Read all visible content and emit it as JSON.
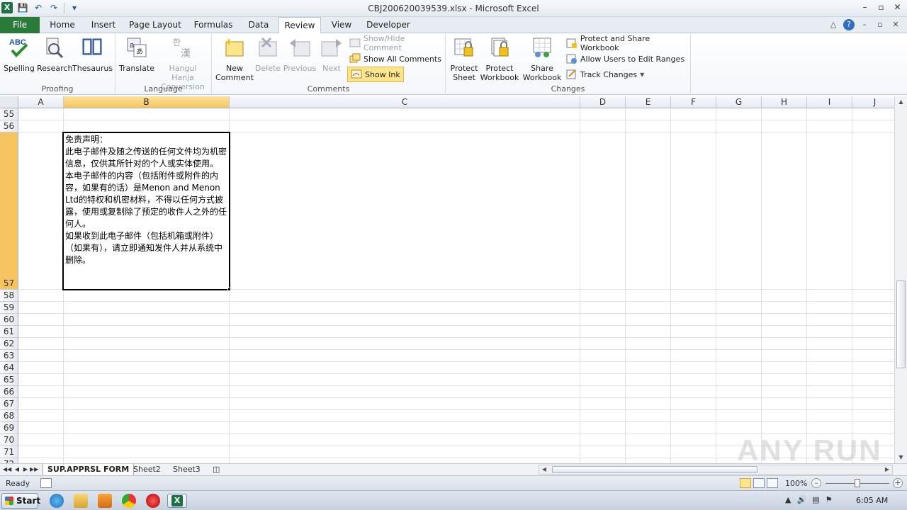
{
  "window": {
    "title": "CBJ200620039539.xlsx - Microsoft Excel",
    "controls": [
      "–",
      "▫",
      "✕"
    ]
  },
  "quick_access": {
    "logo": "X"
  },
  "ribbon": {
    "tabs": [
      "File",
      "Home",
      "Insert",
      "Page Layout",
      "Formulas",
      "Data",
      "Review",
      "View",
      "Developer"
    ],
    "active_tab": "Review",
    "groups": {
      "proofing": {
        "label": "Proofing",
        "buttons": [
          "Spelling",
          "Research",
          "Thesaurus"
        ]
      },
      "language": {
        "label": "Language",
        "translate": "Translate",
        "hangul_line1": "Hangul Hanja",
        "hangul_line2": "Conversion"
      },
      "comments": {
        "label": "Comments",
        "new_line1": "New",
        "new_line2": "Comment",
        "delete": "Delete",
        "previous": "Previous",
        "next": "Next",
        "show_hide": "Show/Hide Comment",
        "show_all": "Show All Comments",
        "show_ink": "Show Ink"
      },
      "changes": {
        "label": "Changes",
        "protect_sheet_line1": "Protect",
        "protect_sheet_line2": "Sheet",
        "protect_wb_line1": "Protect",
        "protect_wb_line2": "Workbook",
        "share_wb_line1": "Share",
        "share_wb_line2": "Workbook",
        "protect_share": "Protect and Share Workbook",
        "allow_users": "Allow Users to Edit Ranges",
        "track_changes": "Track Changes"
      }
    }
  },
  "grid": {
    "columns": [
      "A",
      "B",
      "C",
      "D",
      "E",
      "F",
      "G",
      "H",
      "I",
      "J"
    ],
    "selected_column": "B",
    "rows": [
      "55",
      "56",
      "57",
      "58",
      "59",
      "60",
      "61",
      "62",
      "63",
      "64",
      "65",
      "66",
      "67",
      "68",
      "69",
      "70",
      "71",
      "72"
    ],
    "selected_row": "57",
    "active_cell": {
      "ref": "B57",
      "text": "免责声明：\n此电子邮件及随之传送的任何文件均为机密信息，仅供其所针对的个人或实体使用。\n本电子邮件的内容（包括附件或附件的内容，如果有的话）是Menon and Menon\nLtd的特权和机密材料，不得以任何方式披露，使用或复制除了预定的收件人之外的任何人。\n如果收到此电子邮件（包括机箱或附件）（如果有），请立即通知发件人并从系统中删除。"
    }
  },
  "sheets": {
    "tabs": [
      "SUP.APPRSL FORM",
      "Sheet2",
      "Sheet3"
    ],
    "active": "SUP.APPRSL FORM"
  },
  "status": {
    "ready": "Ready",
    "zoom": "100%"
  },
  "taskbar": {
    "start": "Start",
    "clock": "6:05 AM"
  },
  "watermark": "ANY RUN",
  "colors": {
    "file_tab": "#2a7a3a",
    "selection_header": "#f6c45f",
    "excel_green": "#1e7145",
    "show_ink_highlight": "#fde58c"
  }
}
